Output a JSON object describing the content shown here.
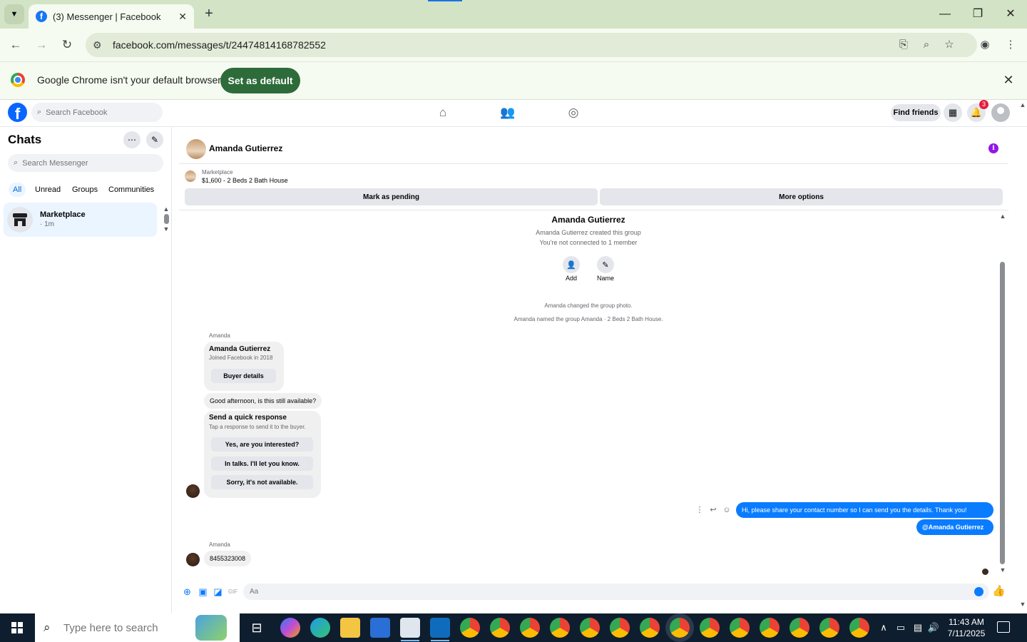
{
  "browser": {
    "tab_title": "(3) Messenger | Facebook",
    "url": "facebook.com/messages/t/24474814168782552",
    "infobar_text": "Google Chrome isn't your default browser",
    "set_default_label": "Set as default"
  },
  "facebook": {
    "search_placeholder": "Search Facebook",
    "find_friends_label": "Find friends",
    "notification_count": "3"
  },
  "sidebar": {
    "title": "Chats",
    "search_placeholder": "Search Messenger",
    "filters": [
      "All",
      "Unread",
      "Groups",
      "Communities"
    ],
    "chats": [
      {
        "name": "Marketplace",
        "time": "· 1m"
      }
    ]
  },
  "conversation": {
    "header_name": "Amanda Gutierrez",
    "marketplace_label": "Marketplace",
    "listing_title": "$1,600 - 2 Beds 2 Bath House",
    "mark_pending_label": "Mark as pending",
    "more_options_label": "More options",
    "group": {
      "name": "Amanda Gutierrez",
      "created_line": "Amanda Gutierrez created this group",
      "connected_line": "You're not connected to 1 member",
      "add_label": "Add",
      "name_label": "Name"
    },
    "system_messages": [
      "Amanda changed the group photo.",
      "Amanda named the group Amanda · 2 Beds 2 Bath House."
    ],
    "sender_label": "Amanda",
    "buyer_card": {
      "name": "Amanda Gutierrez",
      "joined": "Joined Facebook in 2018",
      "button": "Buyer details"
    },
    "incoming_1": "Good afternoon, is this still available?",
    "quick_response": {
      "title": "Send a quick response",
      "subtitle": "Tap a response to send it to the buyer.",
      "options": [
        "Yes, are you interested?",
        "In talks. I'll let you know.",
        "Sorry, it's not available."
      ]
    },
    "outgoing_1": "Hi, please share your contact number so I can send you the details. Thank you!",
    "outgoing_2": "@Amanda Gutierrez",
    "sender_label_2": "Amanda",
    "incoming_2": "8455323008",
    "composer_placeholder": "Aa"
  },
  "taskbar": {
    "search_placeholder": "Type here to search",
    "time": "11:43 AM",
    "date": "7/11/2025"
  },
  "colors": {
    "messenger_blue": "#0a7cff",
    "facebook_blue": "#0866ff",
    "chrome_green": "#2e6b3a"
  }
}
